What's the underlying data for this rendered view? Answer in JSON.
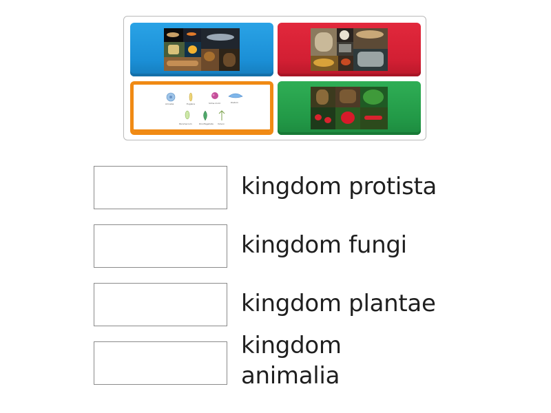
{
  "tiles": [
    {
      "id": "tile-animalia",
      "icon": "animal-collage-image",
      "color": "#1b8fd6"
    },
    {
      "id": "tile-fungi",
      "icon": "fungi-collage-image",
      "color": "#d21f33"
    },
    {
      "id": "tile-protista",
      "icon": "protista-diagram-image",
      "color": "#f08a14"
    },
    {
      "id": "tile-plantae",
      "icon": "plant-collage-image",
      "color": "#229947"
    }
  ],
  "targets": [
    {
      "label": "kingdom protista"
    },
    {
      "label": "kingdom fungi"
    },
    {
      "label": "kingdom plantae"
    },
    {
      "label": "kingdom animalia"
    }
  ]
}
